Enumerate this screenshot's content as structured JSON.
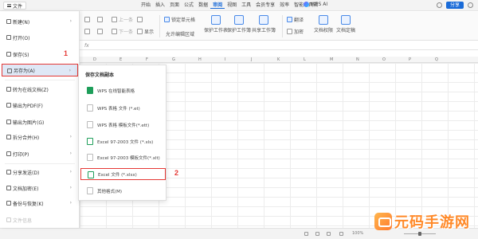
{
  "topbar": {
    "file_label": "文件",
    "tabs": [
      "开始",
      "插入",
      "页面",
      "公式",
      "数据",
      "审阅",
      "视图",
      "工具",
      "会员专享",
      "效率",
      "智能工具箱"
    ],
    "active_tab": "审阅",
    "wps_ai": "WPS AI",
    "share_label": "分享"
  },
  "ribbon": {
    "prev_comment": "上一条",
    "next_comment": "下一条",
    "show_label": "显示",
    "lock_cells": "锁定单元格",
    "allow_edit_range": "允许编辑区域",
    "protect_sheet": "保护工作表",
    "protect_workbook": "保护工作簿",
    "share_workbook": "共享工作簿",
    "translate": "翻译",
    "encrypt": "加密",
    "doc_permission": "文档权限",
    "doc_finalize": "文档定稿"
  },
  "sheet": {
    "col_letters": [
      "D",
      "E",
      "F",
      "G",
      "H",
      "I",
      "J",
      "K",
      "L",
      "M",
      "N",
      "O",
      "P",
      "Q"
    ]
  },
  "file_menu": {
    "items": [
      {
        "label": "新建(N)",
        "has_sub": true
      },
      {
        "label": "打开(O)",
        "has_sub": false
      },
      {
        "label": "保存(S)",
        "has_sub": false
      },
      {
        "label": "另存为(A)",
        "has_sub": true
      },
      {
        "label": "转为在线文档(Z)",
        "has_sub": false
      },
      {
        "label": "输出为PDF(F)",
        "has_sub": false
      },
      {
        "label": "输出为图片(G)",
        "has_sub": false
      },
      {
        "label": "拆分合并(H)",
        "has_sub": true
      },
      {
        "label": "打印(P)",
        "has_sub": true
      },
      {
        "label": "分享发送(D)",
        "has_sub": true
      },
      {
        "label": "文档加密(E)",
        "has_sub": true
      },
      {
        "label": "备份与恢复(K)",
        "has_sub": true
      },
      {
        "label": "文件信息",
        "has_sub": false
      }
    ],
    "annotation": "1"
  },
  "submenu": {
    "title": "保存文档副本",
    "items": [
      "WPS 在线智能表格",
      "WPS 表格 文件 (*.et)",
      "WPS 表格 模板文件(*.ett)",
      "Excel 97-2003 文件 (*.xls)",
      "Excel 97-2003 模板文件(*.xlt)",
      "Excel 文件 (*.xlsx)",
      "其他格式(M)"
    ],
    "annotation": "2"
  },
  "status": {
    "zoom": "100%"
  },
  "watermark": "元码手游网"
}
